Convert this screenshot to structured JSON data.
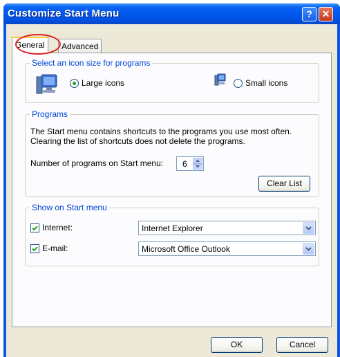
{
  "window": {
    "title": "Customize Start Menu",
    "help_glyph": "?",
    "close_glyph": "✕"
  },
  "tabs": {
    "general": "General",
    "advanced": "Advanced"
  },
  "icon_size": {
    "legend": "Select an icon size for programs",
    "large_label": "Large icons",
    "small_label": "Small icons",
    "selected": "large"
  },
  "programs": {
    "legend": "Programs",
    "description_line1": "The Start menu contains shortcuts to the programs you use most often.",
    "description_line2": "Clearing the list of shortcuts does not delete the programs.",
    "count_label": "Number of programs on Start menu:",
    "count_value": "6",
    "clear_button": "Clear List"
  },
  "show_on_start": {
    "legend": "Show on Start menu",
    "internet_label": "Internet:",
    "internet_value": "Internet Explorer",
    "internet_checked": true,
    "email_label": "E-mail:",
    "email_value": "Microsoft Office Outlook",
    "email_checked": true
  },
  "footer": {
    "ok": "OK",
    "cancel": "Cancel"
  },
  "colors": {
    "titlebar": "#0058ee",
    "legend": "#0046d5",
    "annotation": "#e02020",
    "radio_dot": "#21a121"
  },
  "icons": [
    "monitor-large-icon",
    "monitor-small-icon",
    "help-icon",
    "close-icon",
    "spin-arrows-icon",
    "dropdown-arrow-icon",
    "checkmark-icon"
  ]
}
